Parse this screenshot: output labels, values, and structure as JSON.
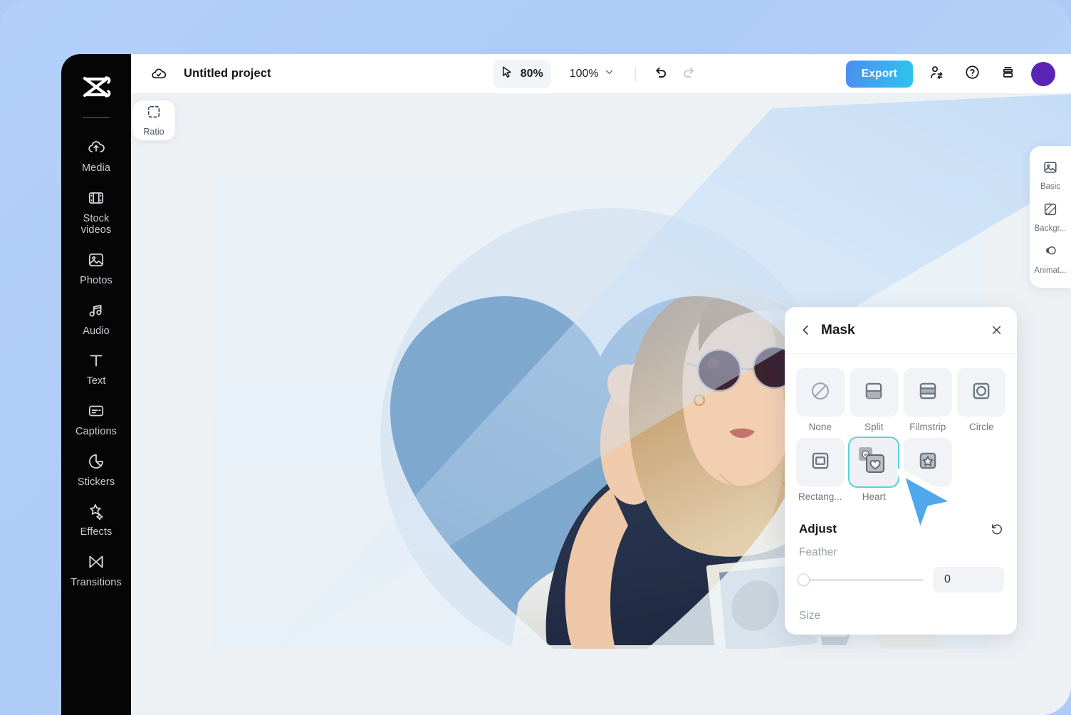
{
  "app": {
    "name": "CapCut Online Editor",
    "logo_icon": "capcut-logo-icon",
    "accent_blue": "#4a8ef0",
    "accent_cyan": "#2ec5ef",
    "selection_color": "#54d4dd",
    "avatar_color": "#5b23b6",
    "page_background": "#aecbf7"
  },
  "sidebar": {
    "items": [
      {
        "label": "Media",
        "icon": "cloud-upload-icon"
      },
      {
        "label": "Stock\nvideos",
        "icon": "filmstrip-icon"
      },
      {
        "label": "Photos",
        "icon": "image-icon"
      },
      {
        "label": "Audio",
        "icon": "music-note-icon"
      },
      {
        "label": "Text",
        "icon": "text-t-icon"
      },
      {
        "label": "Captions",
        "icon": "captions-icon"
      },
      {
        "label": "Stickers",
        "icon": "sticker-icon"
      },
      {
        "label": "Effects",
        "icon": "sparkle-star-icon"
      },
      {
        "label": "Transitions",
        "icon": "transitions-icon"
      }
    ]
  },
  "topbar": {
    "cloud_icon": "cloud-saved-icon",
    "project_title": "Untitled project",
    "cursor_tool": {
      "icon": "cursor-arrow-icon",
      "value": "80%"
    },
    "zoom": {
      "value": "100%",
      "chevron": "chevron-down-icon"
    },
    "undo_icon": "undo-icon",
    "redo_icon": "redo-icon",
    "export_label": "Export",
    "collaborate_icon": "add-collaborator-icon",
    "help_icon": "question-circle-icon",
    "layers_icon": "stack-layers-icon",
    "avatar": "user-avatar"
  },
  "canvas": {
    "ratio_button": {
      "label": "Ratio",
      "icon": "crop-ratio-icon"
    }
  },
  "mini_rail": {
    "items": [
      {
        "label": "Basic",
        "icon": "image-basic-icon"
      },
      {
        "label": "Backgr...",
        "icon": "background-hatch-icon"
      },
      {
        "label": "Animat...",
        "icon": "animation-rings-icon"
      }
    ]
  },
  "mask_panel": {
    "back_icon": "chevron-left-icon",
    "title": "Mask",
    "close_icon": "close-x-icon",
    "options": [
      {
        "label": "None",
        "icon": "no-mask-icon",
        "selected": false
      },
      {
        "label": "Split",
        "icon": "split-mask-icon",
        "selected": false
      },
      {
        "label": "Filmstrip",
        "icon": "filmstrip-mask-icon",
        "selected": false
      },
      {
        "label": "Circle",
        "icon": "circle-mask-icon",
        "selected": false
      },
      {
        "label": "Rectang...",
        "icon": "rectangle-mask-icon",
        "selected": false
      },
      {
        "label": "Heart",
        "icon": "heart-mask-icon",
        "selected": true
      },
      {
        "label": "Star",
        "icon": "star-mask-icon",
        "selected": false
      }
    ],
    "adjust": {
      "title": "Adjust",
      "reset_icon": "reset-circular-arrow-icon",
      "feather": {
        "label": "Feather",
        "value": "0",
        "percent": 0
      },
      "size": {
        "label": "Size"
      }
    }
  },
  "pointer": {
    "icon": "mouse-pointer-icon",
    "color": "#4fa8ec"
  }
}
